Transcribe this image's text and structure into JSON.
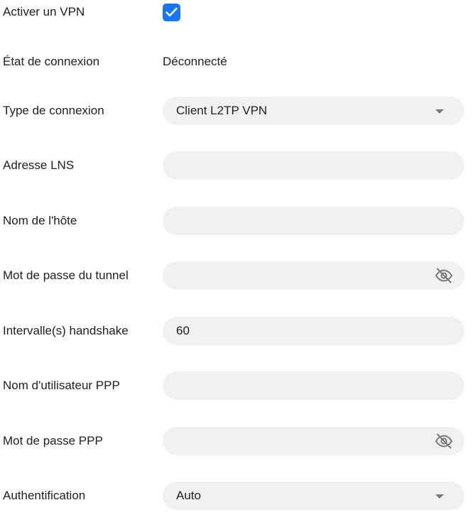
{
  "form": {
    "enable_vpn": {
      "label": "Activer un VPN",
      "checked": true,
      "icon": "check-icon",
      "accent_color": "#1777f0"
    },
    "connection_state": {
      "label": "État de connexion",
      "value": "Déconnecté"
    },
    "connection_type": {
      "label": "Type de connexion",
      "selected": "Client L2TP VPN",
      "icon": "chevron-down-icon"
    },
    "lns_address": {
      "label": "Adresse LNS",
      "value": ""
    },
    "host_name": {
      "label": "Nom de l'hôte",
      "value": ""
    },
    "tunnel_password": {
      "label": "Mot de passe du tunnel",
      "value": "",
      "icon": "eye-off-icon"
    },
    "handshake_interval": {
      "label": "Intervalle(s) handshake",
      "value": "60"
    },
    "ppp_username": {
      "label": "Nom d'utilisateur PPP",
      "value": ""
    },
    "ppp_password": {
      "label": "Mot de passe PPP",
      "value": "",
      "icon": "eye-off-icon"
    },
    "authentication": {
      "label": "Authentification",
      "selected": "Auto",
      "icon": "chevron-down-icon"
    }
  },
  "colors": {
    "field_background": "#f1f1f1",
    "text": "#1f1f1f",
    "icon_gray": "#7a7a7a"
  }
}
